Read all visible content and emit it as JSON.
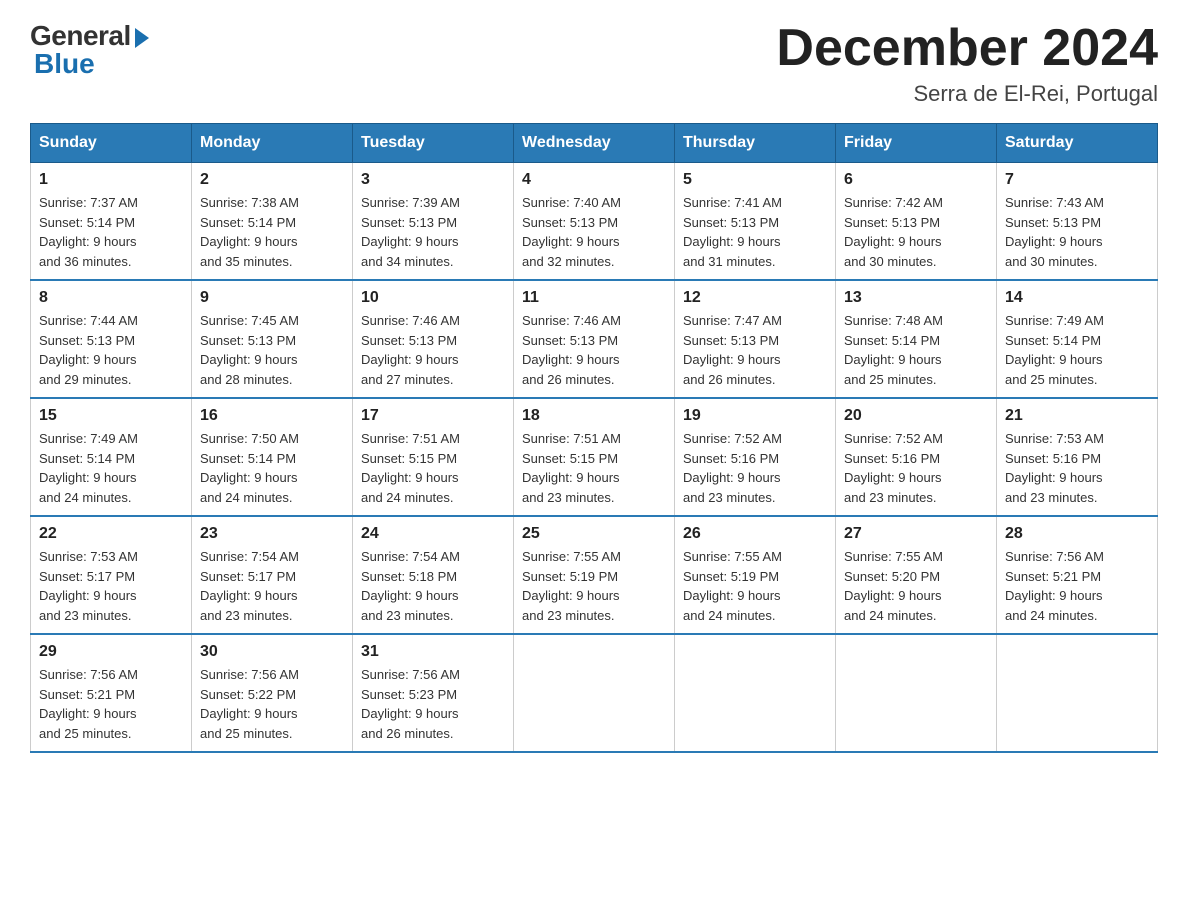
{
  "logo": {
    "general": "General",
    "blue": "Blue"
  },
  "header": {
    "month": "December 2024",
    "location": "Serra de El-Rei, Portugal"
  },
  "days": [
    "Sunday",
    "Monday",
    "Tuesday",
    "Wednesday",
    "Thursday",
    "Friday",
    "Saturday"
  ],
  "weeks": [
    [
      {
        "day": "1",
        "sunrise": "7:37 AM",
        "sunset": "5:14 PM",
        "daylight": "9 hours and 36 minutes."
      },
      {
        "day": "2",
        "sunrise": "7:38 AM",
        "sunset": "5:14 PM",
        "daylight": "9 hours and 35 minutes."
      },
      {
        "day": "3",
        "sunrise": "7:39 AM",
        "sunset": "5:13 PM",
        "daylight": "9 hours and 34 minutes."
      },
      {
        "day": "4",
        "sunrise": "7:40 AM",
        "sunset": "5:13 PM",
        "daylight": "9 hours and 32 minutes."
      },
      {
        "day": "5",
        "sunrise": "7:41 AM",
        "sunset": "5:13 PM",
        "daylight": "9 hours and 31 minutes."
      },
      {
        "day": "6",
        "sunrise": "7:42 AM",
        "sunset": "5:13 PM",
        "daylight": "9 hours and 30 minutes."
      },
      {
        "day": "7",
        "sunrise": "7:43 AM",
        "sunset": "5:13 PM",
        "daylight": "9 hours and 30 minutes."
      }
    ],
    [
      {
        "day": "8",
        "sunrise": "7:44 AM",
        "sunset": "5:13 PM",
        "daylight": "9 hours and 29 minutes."
      },
      {
        "day": "9",
        "sunrise": "7:45 AM",
        "sunset": "5:13 PM",
        "daylight": "9 hours and 28 minutes."
      },
      {
        "day": "10",
        "sunrise": "7:46 AM",
        "sunset": "5:13 PM",
        "daylight": "9 hours and 27 minutes."
      },
      {
        "day": "11",
        "sunrise": "7:46 AM",
        "sunset": "5:13 PM",
        "daylight": "9 hours and 26 minutes."
      },
      {
        "day": "12",
        "sunrise": "7:47 AM",
        "sunset": "5:13 PM",
        "daylight": "9 hours and 26 minutes."
      },
      {
        "day": "13",
        "sunrise": "7:48 AM",
        "sunset": "5:14 PM",
        "daylight": "9 hours and 25 minutes."
      },
      {
        "day": "14",
        "sunrise": "7:49 AM",
        "sunset": "5:14 PM",
        "daylight": "9 hours and 25 minutes."
      }
    ],
    [
      {
        "day": "15",
        "sunrise": "7:49 AM",
        "sunset": "5:14 PM",
        "daylight": "9 hours and 24 minutes."
      },
      {
        "day": "16",
        "sunrise": "7:50 AM",
        "sunset": "5:14 PM",
        "daylight": "9 hours and 24 minutes."
      },
      {
        "day": "17",
        "sunrise": "7:51 AM",
        "sunset": "5:15 PM",
        "daylight": "9 hours and 24 minutes."
      },
      {
        "day": "18",
        "sunrise": "7:51 AM",
        "sunset": "5:15 PM",
        "daylight": "9 hours and 23 minutes."
      },
      {
        "day": "19",
        "sunrise": "7:52 AM",
        "sunset": "5:16 PM",
        "daylight": "9 hours and 23 minutes."
      },
      {
        "day": "20",
        "sunrise": "7:52 AM",
        "sunset": "5:16 PM",
        "daylight": "9 hours and 23 minutes."
      },
      {
        "day": "21",
        "sunrise": "7:53 AM",
        "sunset": "5:16 PM",
        "daylight": "9 hours and 23 minutes."
      }
    ],
    [
      {
        "day": "22",
        "sunrise": "7:53 AM",
        "sunset": "5:17 PM",
        "daylight": "9 hours and 23 minutes."
      },
      {
        "day": "23",
        "sunrise": "7:54 AM",
        "sunset": "5:17 PM",
        "daylight": "9 hours and 23 minutes."
      },
      {
        "day": "24",
        "sunrise": "7:54 AM",
        "sunset": "5:18 PM",
        "daylight": "9 hours and 23 minutes."
      },
      {
        "day": "25",
        "sunrise": "7:55 AM",
        "sunset": "5:19 PM",
        "daylight": "9 hours and 23 minutes."
      },
      {
        "day": "26",
        "sunrise": "7:55 AM",
        "sunset": "5:19 PM",
        "daylight": "9 hours and 24 minutes."
      },
      {
        "day": "27",
        "sunrise": "7:55 AM",
        "sunset": "5:20 PM",
        "daylight": "9 hours and 24 minutes."
      },
      {
        "day": "28",
        "sunrise": "7:56 AM",
        "sunset": "5:21 PM",
        "daylight": "9 hours and 24 minutes."
      }
    ],
    [
      {
        "day": "29",
        "sunrise": "7:56 AM",
        "sunset": "5:21 PM",
        "daylight": "9 hours and 25 minutes."
      },
      {
        "day": "30",
        "sunrise": "7:56 AM",
        "sunset": "5:22 PM",
        "daylight": "9 hours and 25 minutes."
      },
      {
        "day": "31",
        "sunrise": "7:56 AM",
        "sunset": "5:23 PM",
        "daylight": "9 hours and 26 minutes."
      },
      null,
      null,
      null,
      null
    ]
  ],
  "labels": {
    "sunrise": "Sunrise:",
    "sunset": "Sunset:",
    "daylight": "Daylight:"
  }
}
